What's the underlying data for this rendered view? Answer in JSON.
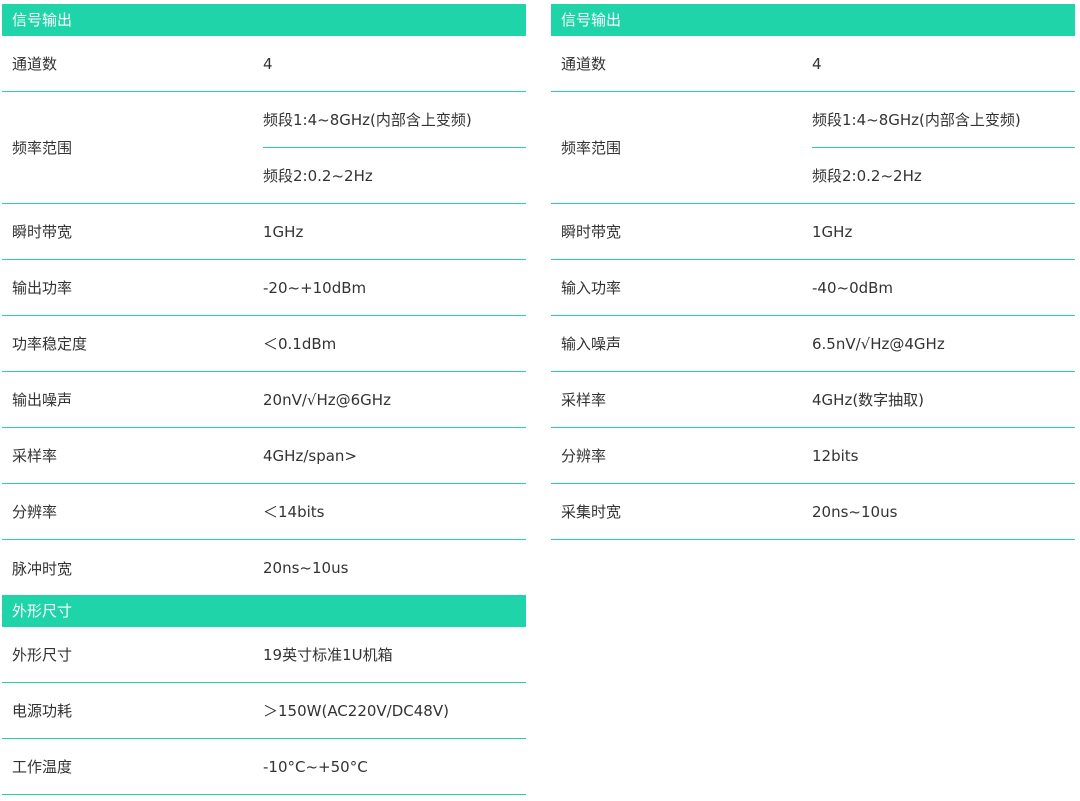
{
  "left": {
    "title": "信号输出",
    "rows": [
      {
        "label": "通道数",
        "value": "4"
      },
      {
        "label": "频率范围",
        "values": [
          "频段1:4~8GHz(内部含上变频)",
          "频段2:0.2~2Hz"
        ]
      },
      {
        "label": "瞬时带宽",
        "value": "1GHz"
      },
      {
        "label": "输出功率",
        "value": "-20~+10dBm"
      },
      {
        "label": "功率稳定度",
        "value": "＜0.1dBm"
      },
      {
        "label": "输出噪声",
        "value": "20nV/√Hz@6GHz"
      },
      {
        "label": "采样率",
        "value": "4GHz/span>"
      },
      {
        "label": "分辨率",
        "value": "＜14bits"
      },
      {
        "label": "脉冲时宽",
        "value": "20ns~10us"
      }
    ]
  },
  "right": {
    "title": "信号输出",
    "rows": [
      {
        "label": "通道数",
        "value": "4"
      },
      {
        "label": "频率范围",
        "values": [
          "频段1:4~8GHz(内部含上变频)",
          "频段2:0.2~2Hz"
        ]
      },
      {
        "label": "瞬时带宽",
        "value": "1GHz"
      },
      {
        "label": "输入功率",
        "value": "-40~0dBm"
      },
      {
        "label": "输入噪声",
        "value": "6.5nV/√Hz@4GHz"
      },
      {
        "label": "采样率",
        "value": "4GHz(数字抽取)"
      },
      {
        "label": "分辨率",
        "value": "12bits"
      },
      {
        "label": "采集时宽",
        "value": "20ns~10us"
      }
    ]
  },
  "bottom": {
    "title": "外形尺寸",
    "rows": [
      {
        "label": "外形尺寸",
        "value": "19英寸标准1U机箱"
      },
      {
        "label": "电源功耗",
        "value": "＞150W(AC220V/DC48V)"
      },
      {
        "label": "工作温度",
        "value": "-10°C~+50°C"
      }
    ]
  },
  "colors": {
    "accent": "#1ed4a8",
    "text": "#333333"
  }
}
